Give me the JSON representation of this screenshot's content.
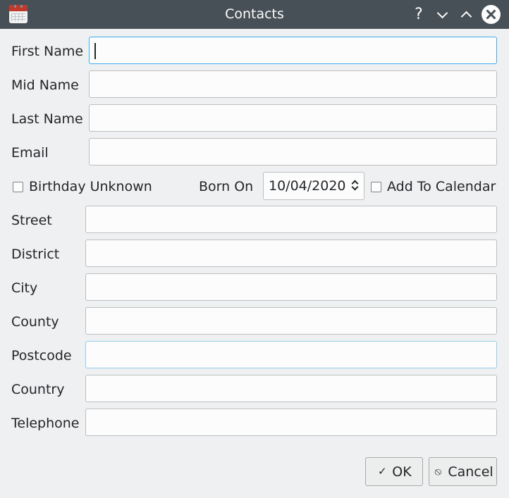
{
  "window": {
    "title": "Contacts"
  },
  "titlebar": {
    "help_glyph": "?"
  },
  "form": {
    "first_name_label": "First Name",
    "mid_name_label": "Mid Name",
    "last_name_label": "Last Name",
    "email_label": "Email",
    "birthday_unknown_label": "Birthday Unknown",
    "born_on_label": "Born On",
    "born_on_value": "10/04/2020",
    "add_to_calendar_label": "Add To Calendar",
    "street_label": "Street",
    "district_label": "District",
    "city_label": "City",
    "county_label": "County",
    "postcode_label": "Postcode",
    "country_label": "Country",
    "telephone_label": "Telephone"
  },
  "values": {
    "first_name": "",
    "mid_name": "",
    "last_name": "",
    "email": "",
    "street": "",
    "district": "",
    "city": "",
    "county": "",
    "postcode": "",
    "country": "",
    "telephone": ""
  },
  "checks": {
    "birthday_unknown": false,
    "add_to_calendar": false
  },
  "buttons": {
    "ok_label": "OK",
    "ok_icon": "✓",
    "cancel_label": "Cancel",
    "cancel_icon": "⦸"
  },
  "icons": {
    "app": "calendar-icon",
    "help": "help-icon",
    "minimize": "chevron-down-icon",
    "maximize": "chevron-up-icon",
    "close": "close-icon"
  },
  "colors": {
    "titlebar": "#475057",
    "window": "#eff0f1",
    "focus": "#3daee9",
    "text": "#232629"
  }
}
